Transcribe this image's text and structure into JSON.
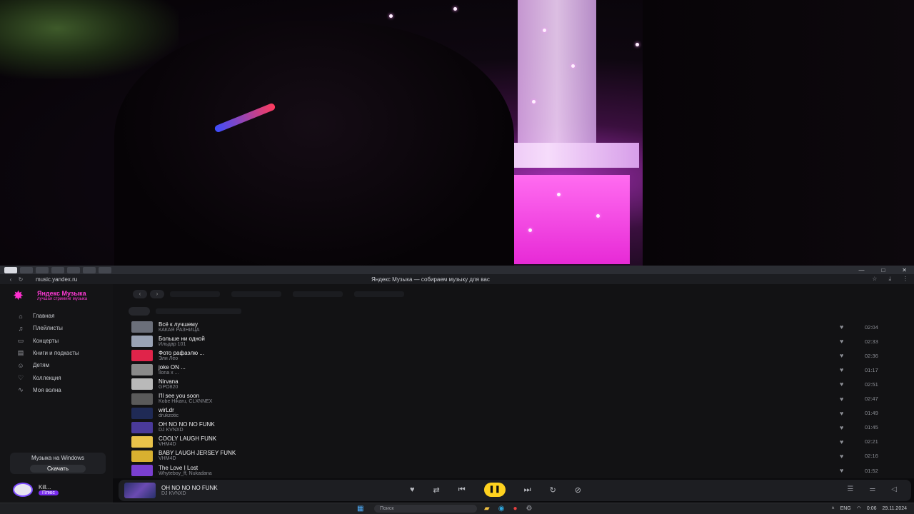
{
  "browser": {
    "url": "music.yandex.ru",
    "page_title": "Яндекс Музыка — собираем музыку для вас"
  },
  "sidebar": {
    "logo_title": "Яндекс Музыка",
    "logo_subtitle": "лучшая стриминг музыка",
    "items": [
      {
        "label": "Главная",
        "icon": "home-icon",
        "glyph": "⌂"
      },
      {
        "label": "Плейлисты",
        "icon": "playlist-icon",
        "glyph": "♫"
      },
      {
        "label": "Концерты",
        "icon": "ticket-icon",
        "glyph": "▭"
      },
      {
        "label": "Книги и подкасты",
        "icon": "book-icon",
        "glyph": "▤"
      },
      {
        "label": "Детям",
        "icon": "kids-icon",
        "glyph": "☺"
      },
      {
        "label": "Коллекция",
        "icon": "heart-icon",
        "glyph": "♡"
      },
      {
        "label": "Моя волна",
        "icon": "wave-icon",
        "glyph": "∿"
      }
    ],
    "promo": {
      "title": "Музыка на Windows",
      "button": "Скачать"
    },
    "user": {
      "name": "Kill...",
      "badge": "Плюс"
    }
  },
  "tracks": [
    {
      "title": "Всё к лучшему",
      "artist": "КАКАЯ РАЗНИЦА",
      "duration": "02:04",
      "color": "#6b6f7a"
    },
    {
      "title": "Больше ни одной",
      "artist": "Ильдар 101",
      "duration": "02:33",
      "color": "#9aa3b5"
    },
    {
      "title": "Фото рафаэлю ...",
      "artist": "Эли Лео",
      "duration": "02:36",
      "color": "#e0244a"
    },
    {
      "title": "joke ON ...",
      "artist": "Ilona x ...",
      "duration": "01:17",
      "color": "#8a8a8a"
    },
    {
      "title": "Nirvana",
      "artist": "GPO820",
      "duration": "02:51",
      "color": "#b9b9b9"
    },
    {
      "title": "I'll see you soon",
      "artist": "Kobe Hikaru, CLXNNEX",
      "duration": "02:47",
      "color": "#5a5a5a"
    },
    {
      "title": "wirLdr",
      "artist": "drukzotic",
      "duration": "01:49",
      "color": "#1f2a55"
    },
    {
      "title": "OH NO NO NO FUNK",
      "artist": "DJ KVNXD",
      "duration": "01:45",
      "color": "#4a3a9a"
    },
    {
      "title": "COOLY LAUGH FUNK",
      "artist": "VHM4D",
      "duration": "02:21",
      "color": "#e8c24a"
    },
    {
      "title": "BABY LAUGH JERSEY FUNK",
      "artist": "VHM4D",
      "duration": "02:16",
      "color": "#d8b030"
    },
    {
      "title": "The Love I Lost",
      "artist": "Whyteboy_ff, Nukadana",
      "duration": "01:52",
      "color": "#7a3fd0"
    }
  ],
  "player": {
    "title": "OH NO NO NO FUNK",
    "artist": "DJ KVNXD",
    "accent": "#ffd21f"
  },
  "taskbar": {
    "search_placeholder": "Поиск",
    "lang": "ENG",
    "time": "0:06",
    "date": "29.11.2024"
  }
}
